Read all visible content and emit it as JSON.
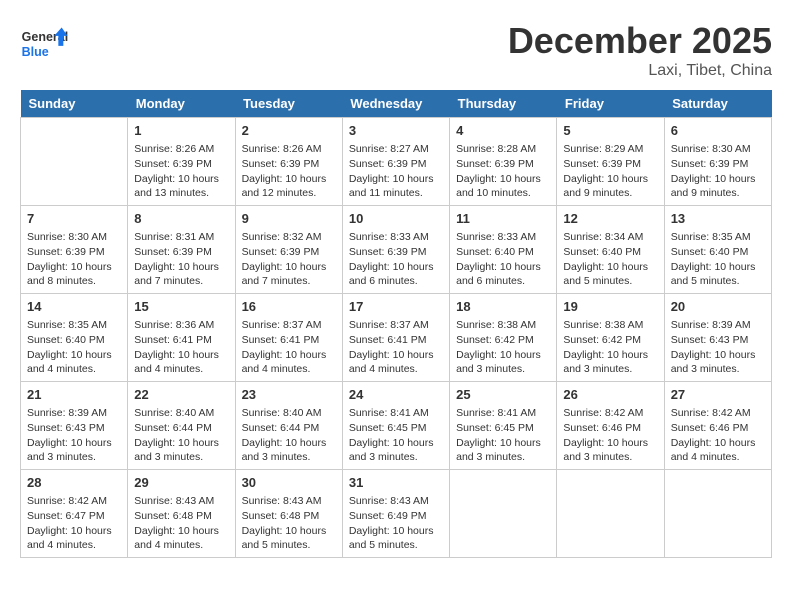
{
  "header": {
    "logo_line1": "General",
    "logo_line2": "Blue",
    "month_year": "December 2025",
    "location": "Laxi, Tibet, China"
  },
  "days_of_week": [
    "Sunday",
    "Monday",
    "Tuesday",
    "Wednesday",
    "Thursday",
    "Friday",
    "Saturday"
  ],
  "weeks": [
    [
      {
        "date": "",
        "info": ""
      },
      {
        "date": "1",
        "info": "Sunrise: 8:26 AM\nSunset: 6:39 PM\nDaylight: 10 hours\nand 13 minutes."
      },
      {
        "date": "2",
        "info": "Sunrise: 8:26 AM\nSunset: 6:39 PM\nDaylight: 10 hours\nand 12 minutes."
      },
      {
        "date": "3",
        "info": "Sunrise: 8:27 AM\nSunset: 6:39 PM\nDaylight: 10 hours\nand 11 minutes."
      },
      {
        "date": "4",
        "info": "Sunrise: 8:28 AM\nSunset: 6:39 PM\nDaylight: 10 hours\nand 10 minutes."
      },
      {
        "date": "5",
        "info": "Sunrise: 8:29 AM\nSunset: 6:39 PM\nDaylight: 10 hours\nand 9 minutes."
      },
      {
        "date": "6",
        "info": "Sunrise: 8:30 AM\nSunset: 6:39 PM\nDaylight: 10 hours\nand 9 minutes."
      }
    ],
    [
      {
        "date": "7",
        "info": "Sunrise: 8:30 AM\nSunset: 6:39 PM\nDaylight: 10 hours\nand 8 minutes."
      },
      {
        "date": "8",
        "info": "Sunrise: 8:31 AM\nSunset: 6:39 PM\nDaylight: 10 hours\nand 7 minutes."
      },
      {
        "date": "9",
        "info": "Sunrise: 8:32 AM\nSunset: 6:39 PM\nDaylight: 10 hours\nand 7 minutes."
      },
      {
        "date": "10",
        "info": "Sunrise: 8:33 AM\nSunset: 6:39 PM\nDaylight: 10 hours\nand 6 minutes."
      },
      {
        "date": "11",
        "info": "Sunrise: 8:33 AM\nSunset: 6:40 PM\nDaylight: 10 hours\nand 6 minutes."
      },
      {
        "date": "12",
        "info": "Sunrise: 8:34 AM\nSunset: 6:40 PM\nDaylight: 10 hours\nand 5 minutes."
      },
      {
        "date": "13",
        "info": "Sunrise: 8:35 AM\nSunset: 6:40 PM\nDaylight: 10 hours\nand 5 minutes."
      }
    ],
    [
      {
        "date": "14",
        "info": "Sunrise: 8:35 AM\nSunset: 6:40 PM\nDaylight: 10 hours\nand 4 minutes."
      },
      {
        "date": "15",
        "info": "Sunrise: 8:36 AM\nSunset: 6:41 PM\nDaylight: 10 hours\nand 4 minutes."
      },
      {
        "date": "16",
        "info": "Sunrise: 8:37 AM\nSunset: 6:41 PM\nDaylight: 10 hours\nand 4 minutes."
      },
      {
        "date": "17",
        "info": "Sunrise: 8:37 AM\nSunset: 6:41 PM\nDaylight: 10 hours\nand 4 minutes."
      },
      {
        "date": "18",
        "info": "Sunrise: 8:38 AM\nSunset: 6:42 PM\nDaylight: 10 hours\nand 3 minutes."
      },
      {
        "date": "19",
        "info": "Sunrise: 8:38 AM\nSunset: 6:42 PM\nDaylight: 10 hours\nand 3 minutes."
      },
      {
        "date": "20",
        "info": "Sunrise: 8:39 AM\nSunset: 6:43 PM\nDaylight: 10 hours\nand 3 minutes."
      }
    ],
    [
      {
        "date": "21",
        "info": "Sunrise: 8:39 AM\nSunset: 6:43 PM\nDaylight: 10 hours\nand 3 minutes."
      },
      {
        "date": "22",
        "info": "Sunrise: 8:40 AM\nSunset: 6:44 PM\nDaylight: 10 hours\nand 3 minutes."
      },
      {
        "date": "23",
        "info": "Sunrise: 8:40 AM\nSunset: 6:44 PM\nDaylight: 10 hours\nand 3 minutes."
      },
      {
        "date": "24",
        "info": "Sunrise: 8:41 AM\nSunset: 6:45 PM\nDaylight: 10 hours\nand 3 minutes."
      },
      {
        "date": "25",
        "info": "Sunrise: 8:41 AM\nSunset: 6:45 PM\nDaylight: 10 hours\nand 3 minutes."
      },
      {
        "date": "26",
        "info": "Sunrise: 8:42 AM\nSunset: 6:46 PM\nDaylight: 10 hours\nand 3 minutes."
      },
      {
        "date": "27",
        "info": "Sunrise: 8:42 AM\nSunset: 6:46 PM\nDaylight: 10 hours\nand 4 minutes."
      }
    ],
    [
      {
        "date": "28",
        "info": "Sunrise: 8:42 AM\nSunset: 6:47 PM\nDaylight: 10 hours\nand 4 minutes."
      },
      {
        "date": "29",
        "info": "Sunrise: 8:43 AM\nSunset: 6:48 PM\nDaylight: 10 hours\nand 4 minutes."
      },
      {
        "date": "30",
        "info": "Sunrise: 8:43 AM\nSunset: 6:48 PM\nDaylight: 10 hours\nand 5 minutes."
      },
      {
        "date": "31",
        "info": "Sunrise: 8:43 AM\nSunset: 6:49 PM\nDaylight: 10 hours\nand 5 minutes."
      },
      {
        "date": "",
        "info": ""
      },
      {
        "date": "",
        "info": ""
      },
      {
        "date": "",
        "info": ""
      }
    ]
  ]
}
